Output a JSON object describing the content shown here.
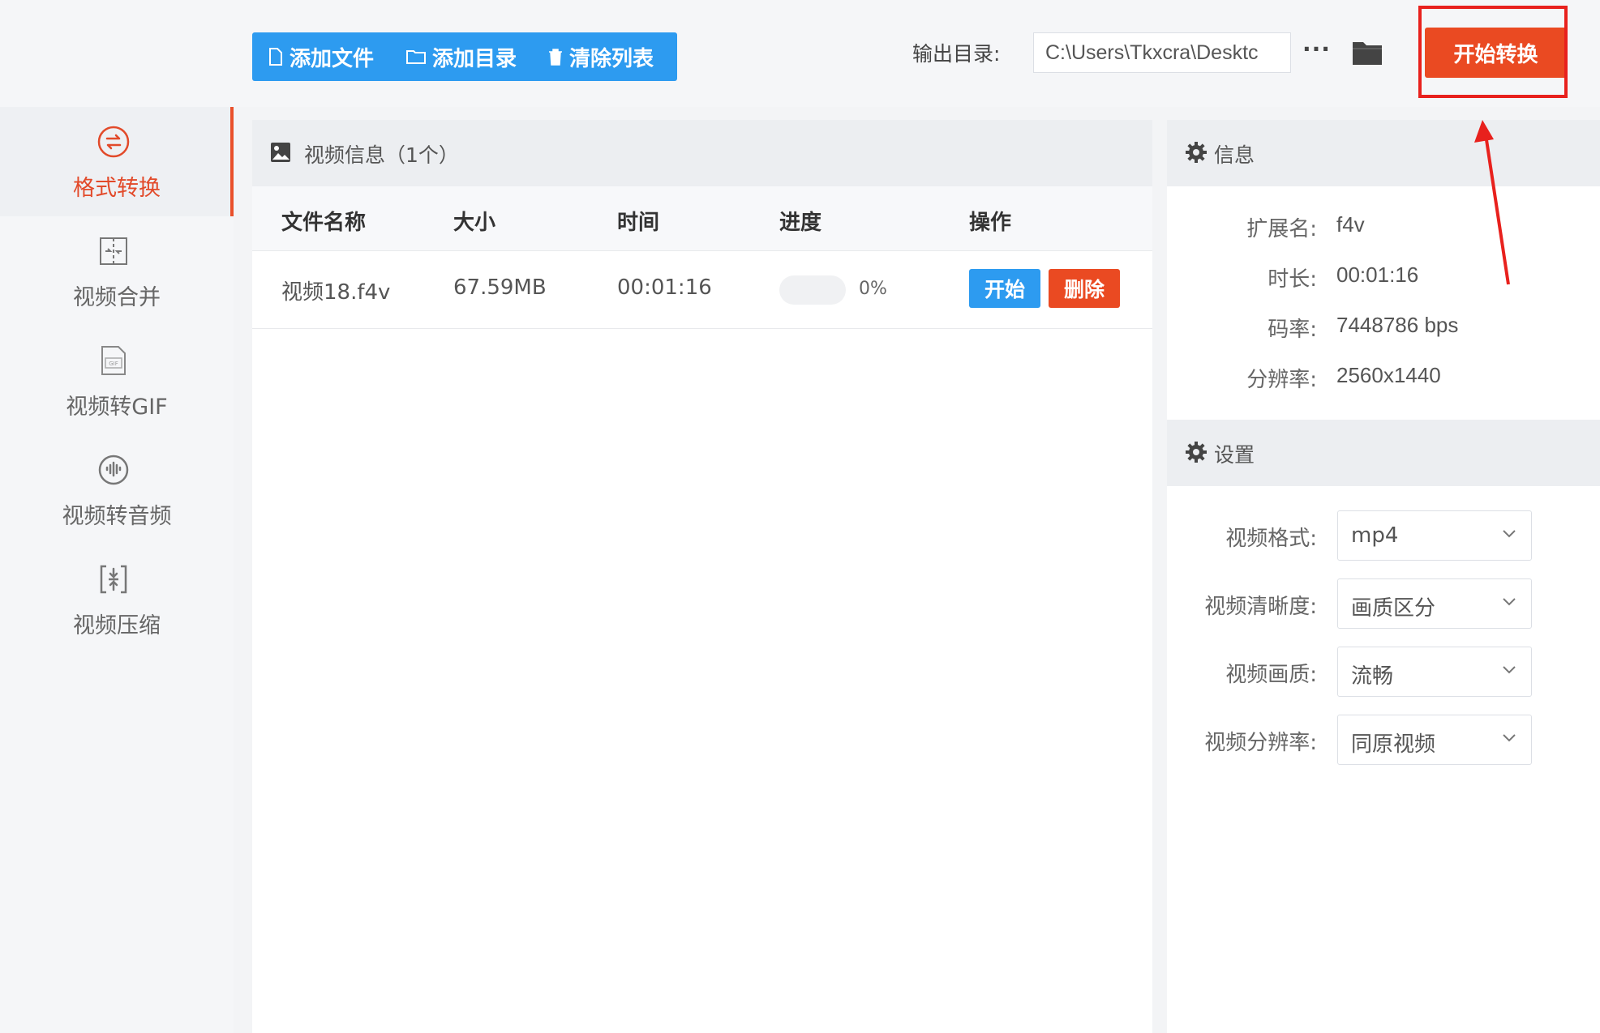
{
  "sidebar": {
    "items": [
      {
        "label": "格式转换",
        "icon": "swap-circle-icon",
        "active": true
      },
      {
        "label": "视频合并",
        "icon": "merge-icon",
        "active": false
      },
      {
        "label": "视频转GIF",
        "icon": "gif-file-icon",
        "active": false
      },
      {
        "label": "视频转音频",
        "icon": "audio-disc-icon",
        "active": false
      },
      {
        "label": "视频压缩",
        "icon": "compress-icon",
        "active": false
      }
    ]
  },
  "toolbar": {
    "add_file": "添加文件",
    "add_dir": "添加目录",
    "clear_list": "清除列表"
  },
  "output": {
    "label": "输出目录:",
    "path": "C:\\Users\\Tkxcra\\Desktc",
    "more": "···",
    "start_all": "开始转换"
  },
  "video_list": {
    "title": "视频信息（1个）",
    "columns": [
      "文件名称",
      "大小",
      "时间",
      "进度",
      "操作"
    ],
    "rows": [
      {
        "name": "视频18.f4v",
        "size": "67.59MB",
        "time": "00:01:16",
        "progress": 0,
        "progress_text": "0%",
        "start": "开始",
        "delete": "删除"
      }
    ]
  },
  "info": {
    "title": "信息",
    "ext_label": "扩展名:",
    "ext": "f4v",
    "duration_label": "时长:",
    "duration": "00:01:16",
    "bitrate_label": "码率:",
    "bitrate": "7448786 bps",
    "resolution_label": "分辨率:",
    "resolution": "2560x1440"
  },
  "settings": {
    "title": "设置",
    "format_label": "视频格式:",
    "format": "mp4",
    "clarity_label": "视频清晰度:",
    "clarity": "画质区分",
    "quality_label": "视频画质:",
    "quality": "流畅",
    "resolution_label": "视频分辨率:",
    "resolution": "同原视频"
  },
  "colors": {
    "accent_blue": "#2d9bf0",
    "accent_red": "#ea4a22",
    "highlight_red": "#e8211d"
  }
}
